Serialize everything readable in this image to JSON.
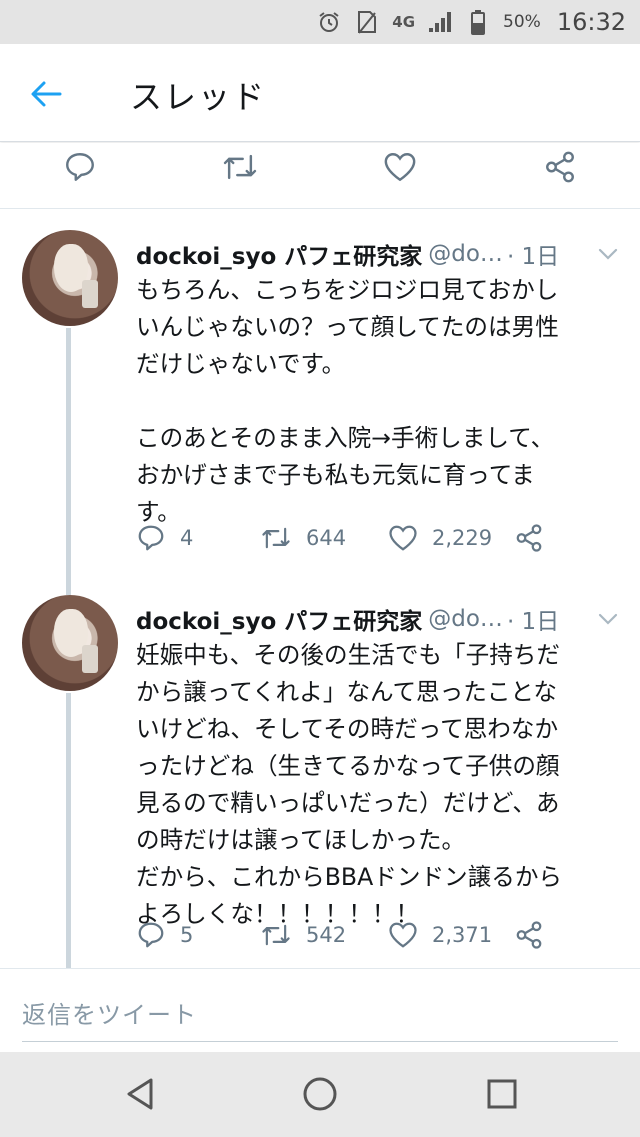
{
  "status_bar": {
    "network": "4G",
    "battery": "50%",
    "time": "16:32"
  },
  "header": {
    "title": "スレッド"
  },
  "tweets": [
    {
      "name": "dockoi_syo パフェ研究家",
      "handle": "@do…",
      "time": "· 1日",
      "text": "もちろん、こっちをジロジロ見ておかし\nいんじゃないの？って顔してたのは男性\nだけじゃないです。\n\nこのあとそのまま入院→手術しまして、\nおかげさまで子も私も元気に育ってま\nす。",
      "replies": "4",
      "retweets": "644",
      "likes": "2,229"
    },
    {
      "name": "dockoi_syo パフェ研究家",
      "handle": "@do…",
      "time": "· 1日",
      "text": "妊娠中も、その後の生活でも「子持ちだ\nから譲ってくれよ」なんて思ったことな\nいけどね、そしてその時だって思わなか\nったけどね（生きてるかなって子供の顔\n見るので精いっぱいだった）だけど、あ\nの時だけは譲ってほしかった。\nだから、これからBBAドンドン譲るから\nよろしくな！！！！！！！",
      "replies": "5",
      "retweets": "542",
      "likes": "2,371"
    }
  ],
  "reply": {
    "placeholder": "返信をツイート"
  },
  "colors": {
    "accent": "#1da1f2",
    "icon_gray": "#657786",
    "thread_line": "#ccd6dd"
  }
}
